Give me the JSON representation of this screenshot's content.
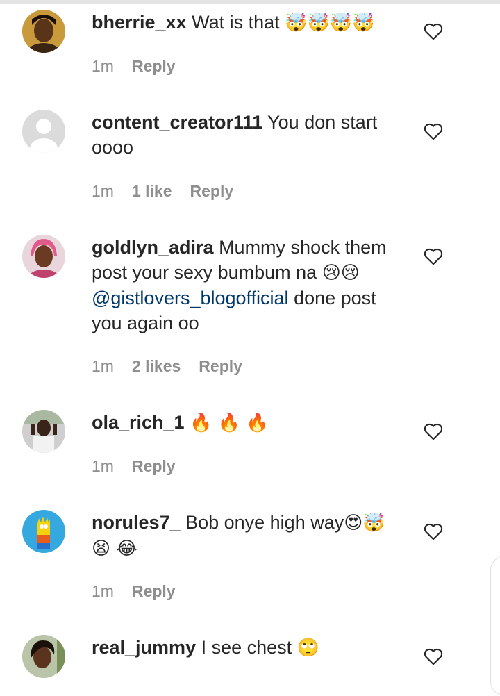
{
  "comments": [
    {
      "username": "bherrie_xx",
      "text": "Wat is that",
      "emoji": "🤯🤯🤯🤯",
      "time": "1m",
      "likes": "",
      "reply": "Reply"
    },
    {
      "username": "content_creator111",
      "text": "You don start oooo",
      "emoji": "",
      "time": "1m",
      "likes": "1 like",
      "reply": "Reply"
    },
    {
      "username": "goldlyn_adira",
      "text": "Mummy shock them post your sexy bumbum na",
      "emoji": "😢😢",
      "mention": "@gistlovers_blogofficial",
      "text_after": "done post you again oo",
      "time": "1m",
      "likes": "2 likes",
      "reply": "Reply"
    },
    {
      "username": "ola_rich_1",
      "text": "",
      "emoji": "🔥 🔥 🔥",
      "time": "1m",
      "likes": "",
      "reply": "Reply"
    },
    {
      "username": "norules7_",
      "text": "Bob onye high way",
      "emoji": "😍🤯😫 😂",
      "time": "1m",
      "likes": "",
      "reply": "Reply"
    },
    {
      "username": "real_jummy",
      "text": "I see chest",
      "emoji": "🙄",
      "time": "",
      "likes": "",
      "reply": ""
    }
  ],
  "icons": {
    "like": "heart-outline-icon",
    "avatar_default": "default-user-avatar"
  },
  "colors": {
    "text": "#262626",
    "meta": "#8e8e8e",
    "mention": "#00376b"
  }
}
